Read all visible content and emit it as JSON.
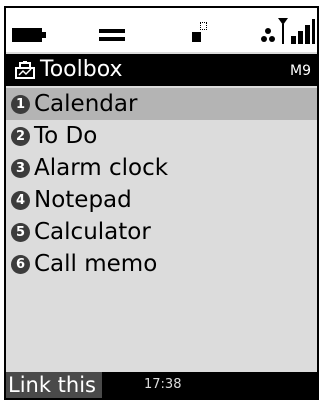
{
  "status_bar": {
    "battery_icon": "battery-full-icon",
    "profile_icon": "equals-icon",
    "network_icon": "network-icon",
    "signal_icon": "signal-strength-icon"
  },
  "header": {
    "icon": "toolbox-icon",
    "title": "Toolbox",
    "mode_indicator": "M9"
  },
  "menu": {
    "selected_index": 0,
    "items": [
      {
        "number": "1",
        "label": "Calendar"
      },
      {
        "number": "2",
        "label": "To Do"
      },
      {
        "number": "3",
        "label": "Alarm clock"
      },
      {
        "number": "4",
        "label": "Notepad"
      },
      {
        "number": "5",
        "label": "Calculator"
      },
      {
        "number": "6",
        "label": "Call memo"
      }
    ]
  },
  "softkeys": {
    "left_label": "Link this",
    "clock": "17:38"
  },
  "colors": {
    "screen_background": "#dcdcdc",
    "selection": "#b4b4b4",
    "bar": "#000000",
    "number_badge": "#3c3c3c"
  }
}
